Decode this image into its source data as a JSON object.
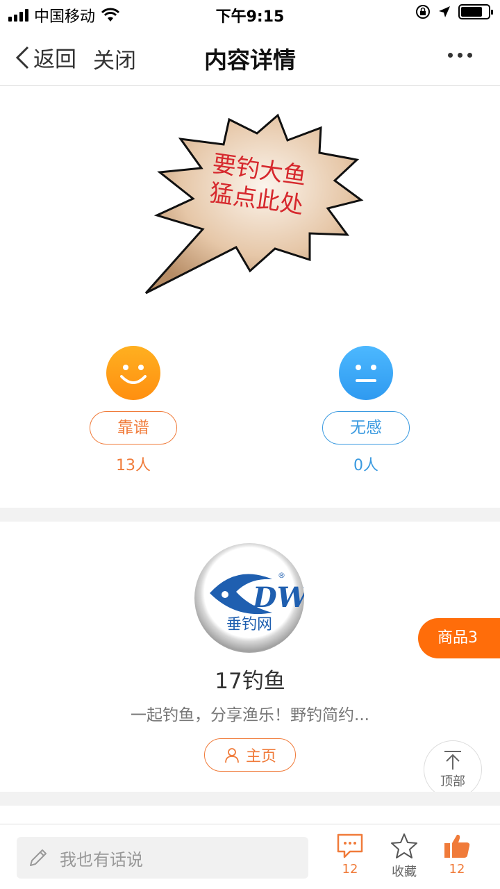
{
  "status_bar": {
    "carrier": "中国移动",
    "time": "下午9:15"
  },
  "nav": {
    "back_label": "返回",
    "close_label": "关闭",
    "title": "内容详情"
  },
  "banner": {
    "line1": "要钓大鱼",
    "line2": "猛点此处"
  },
  "reactions": {
    "like": {
      "label": "靠谱",
      "count": "13人",
      "color": "#f07b3a"
    },
    "neutral": {
      "label": "无感",
      "count": "0人",
      "color": "#3a9ae0"
    }
  },
  "profile": {
    "avatar_text": "DW",
    "avatar_sub": "垂钓网",
    "name": "17钓鱼",
    "description": "一起钓鱼，分享渔乐！野钓简约...",
    "home_label": "主页"
  },
  "floating": {
    "goods_label": "商品3",
    "top_label": "顶部"
  },
  "bottom_bar": {
    "comment_placeholder": "我也有话说",
    "comment_count": "12",
    "favorite_label": "收藏",
    "like_count": "12"
  },
  "colors": {
    "accent_orange": "#f07b3a",
    "accent_blue": "#3a9ae0",
    "goods_orange": "#ff6d0a"
  }
}
